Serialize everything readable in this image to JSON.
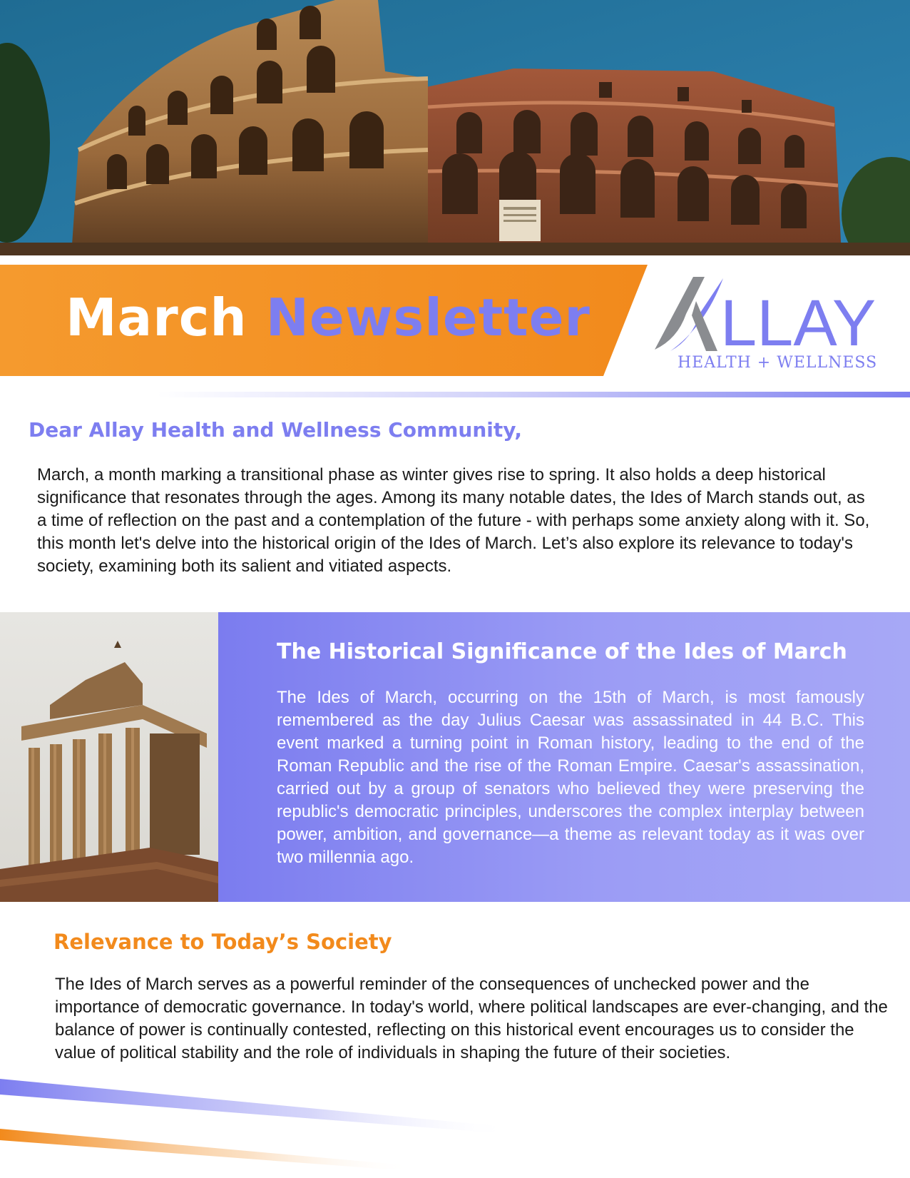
{
  "banner": {
    "title_part1": "March",
    "title_part2": "Newsletter"
  },
  "logo": {
    "name": "LLAY",
    "tagline": "HEALTH + WELLNESS"
  },
  "greeting": "Dear Allay Health and Wellness Community,",
  "intro": "March, a month marking a transitional phase as winter gives rise to spring. It also holds a deep historical significance that resonates through the ages. Among its many notable dates, the Ides of March stands out, as a time of reflection on the past and a contemplation of the future - with perhaps some anxiety along with it. So, this month let's delve into the historical origin of the Ides of March. Let’s also explore its relevance to today's society, examining both its salient and vitiated aspects.",
  "historical": {
    "title": "The Historical Significance of the Ides of March",
    "body": "The Ides of March, occurring on the 15th of March, is most famously remembered as the day Julius Caesar was assassinated in 44 B.C. This event marked a turning point in Roman history, leading to the end of the Roman Republic and the rise of the Roman Empire. Caesar's assassination, carried out by a group of senators who believed they were preserving the republic's democratic principles, underscores the complex interplay between power, ambition, and governance—a theme as relevant today as it was over two millennia ago."
  },
  "relevance": {
    "title": "Relevance to Today’s Society",
    "body": "The Ides of March serves as a powerful reminder of the consequences of unchecked power and the importance of democratic governance. In today's world, where political landscapes are ever-changing, and the balance of power is continually contested, reflecting on this historical event encourages us to consider the value of political stability and the role of individuals in shaping the future of their societies."
  },
  "colors": {
    "accent_purple": "#7d7ef0",
    "accent_orange": "#f28a1c",
    "logo_gray": "#8a8c90"
  },
  "images": {
    "hero": "colosseum-photo",
    "feature": "roman-temple-photo"
  }
}
